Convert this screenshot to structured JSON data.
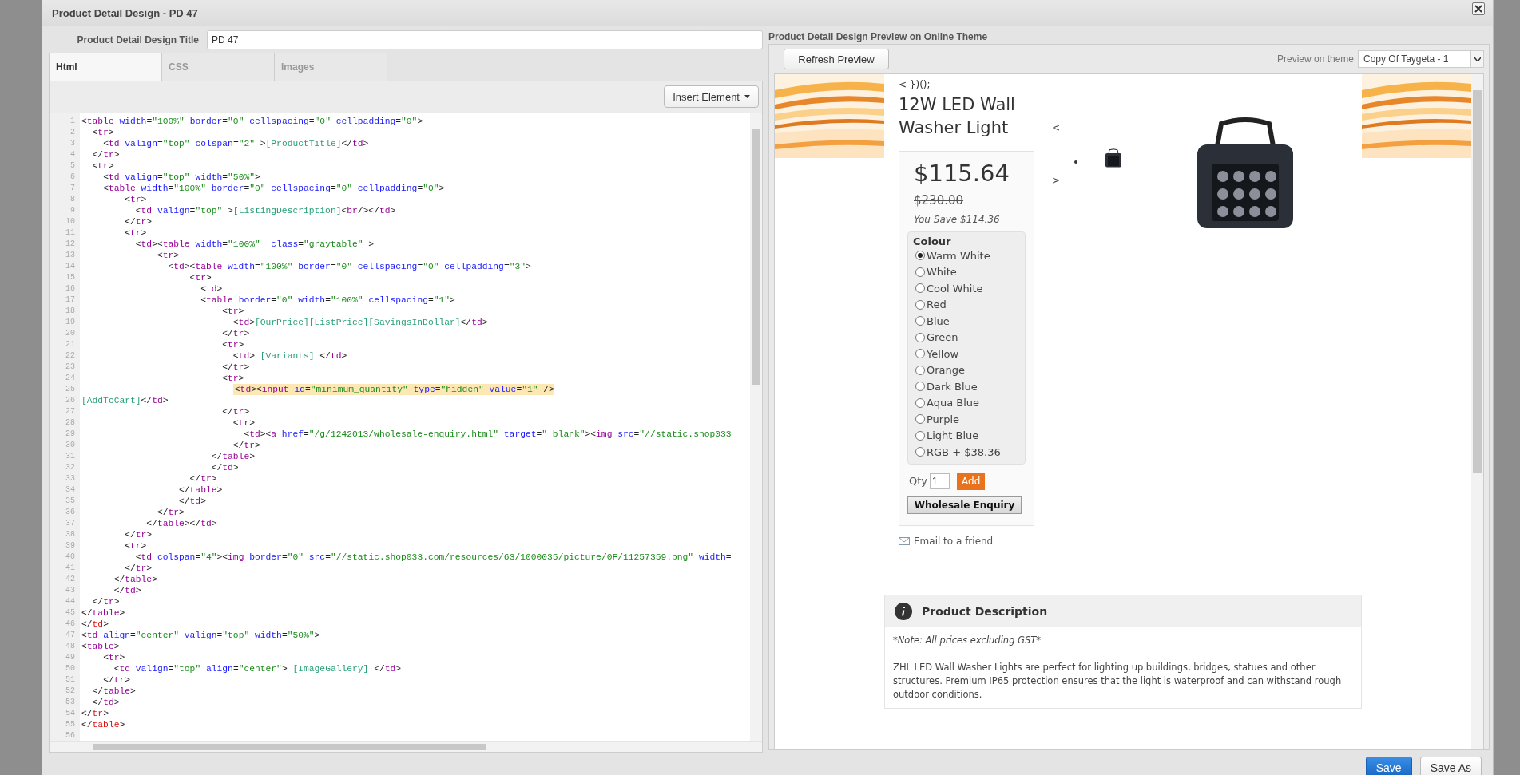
{
  "dialog": {
    "title": "Product Detail Design - PD 47"
  },
  "design_title": {
    "label": "Product Detail Design Title",
    "value": "PD 47"
  },
  "tabs": [
    {
      "label": "Html",
      "selected": true
    },
    {
      "label": "CSS",
      "selected": false
    },
    {
      "label": "Images",
      "selected": false
    }
  ],
  "insert_button": "Insert Element",
  "code_lines": [
    {
      "number": "1",
      "text": "<table width=\"100%\" border=\"0\" cellspacing=\"0\" cellpadding=\"0\">",
      "kind": "plain"
    },
    {
      "number": "2",
      "text": "  <tr>",
      "kind": "plain"
    },
    {
      "number": "3",
      "text": "    <td valign=\"top\" colspan=\"2\" >[ProductTitle]</td>",
      "kind": "plain"
    },
    {
      "number": "4",
      "text": "  </tr>",
      "kind": "plain"
    },
    {
      "number": "5",
      "text": "  <tr>",
      "kind": "plain"
    },
    {
      "number": "6",
      "text": "    <td valign=\"top\" width=\"50%\">",
      "kind": "plain"
    },
    {
      "number": "7",
      "text": "    <table width=\"100%\" border=\"0\" cellspacing=\"0\" cellpadding=\"0\">",
      "kind": "plain"
    },
    {
      "number": "8",
      "text": "        <tr>",
      "kind": "plain"
    },
    {
      "number": "9",
      "text": "          <td valign=\"top\" >[ListingDescription]<br/></td>",
      "kind": "plain"
    },
    {
      "number": "10",
      "text": "        </tr>",
      "kind": "plain"
    },
    {
      "number": "11",
      "text": "        <tr>",
      "kind": "plain"
    },
    {
      "number": "12",
      "text": "          <td><table width=\"100%\"  class=\"graytable\" >",
      "kind": "plain"
    },
    {
      "number": "13",
      "text": "              <tr>",
      "kind": "plain"
    },
    {
      "number": "14",
      "text": "                <td><table width=\"100%\" border=\"0\" cellspacing=\"0\" cellpadding=\"3\">",
      "kind": "plain"
    },
    {
      "number": "15",
      "text": "                    <tr>",
      "kind": "plain"
    },
    {
      "number": "16",
      "text": "                      <td>",
      "kind": "plain"
    },
    {
      "number": "17",
      "text": "                      <table border=\"0\" width=\"100%\" cellspacing=\"1\">",
      "kind": "plain"
    },
    {
      "number": "18",
      "text": "                          <tr>",
      "kind": "plain"
    },
    {
      "number": "19",
      "text": "                            <td>[OurPrice][ListPrice][SavingsInDollar]</td>",
      "kind": "plain"
    },
    {
      "number": "20",
      "text": "                          </tr>",
      "kind": "plain"
    },
    {
      "number": "21",
      "text": "                          <tr>",
      "kind": "plain"
    },
    {
      "number": "22",
      "text": "                            <td> [Variants] </td>",
      "kind": "plain"
    },
    {
      "number": "23",
      "text": "                          </tr>",
      "kind": "plain"
    },
    {
      "number": "24",
      "text": "                          <tr>",
      "kind": "plain"
    },
    {
      "number": "25",
      "text": "                            <td><input id=\"minimum_quantity\" type=\"hidden\" value=\"1\" />",
      "kind": "highlight"
    },
    {
      "number": "26",
      "text": "[AddToCart]</td>",
      "kind": "plain"
    },
    {
      "number": "27",
      "text": "                          </tr>",
      "kind": "plain"
    },
    {
      "number": "28",
      "text": "                            <tr>",
      "kind": "plain"
    },
    {
      "number": "29",
      "text": "                              <td><a href=\"/g/1242013/wholesale-enquiry.html\" target=\"_blank\"><img src=\"//static.shop033",
      "kind": "plain"
    },
    {
      "number": "30",
      "text": "                            </tr>",
      "kind": "plain"
    },
    {
      "number": "31",
      "text": "                        </table>",
      "kind": "plain"
    },
    {
      "number": "32",
      "text": "                        </td>",
      "kind": "plain"
    },
    {
      "number": "33",
      "text": "                    </tr>",
      "kind": "plain"
    },
    {
      "number": "34",
      "text": "                  </table>",
      "kind": "plain"
    },
    {
      "number": "35",
      "text": "                  </td>",
      "kind": "plain"
    },
    {
      "number": "36",
      "text": "              </tr>",
      "kind": "plain"
    },
    {
      "number": "37",
      "text": "            </table></td>",
      "kind": "plain"
    },
    {
      "number": "38",
      "text": "        </tr>",
      "kind": "plain"
    },
    {
      "number": "39",
      "text": "        <tr>",
      "kind": "plain"
    },
    {
      "number": "40",
      "text": "          <td colspan=\"4\"><img border=\"0\" src=\"//static.shop033.com/resources/63/1000035/picture/0F/11257359.png\" width=",
      "kind": "plain"
    },
    {
      "number": "41",
      "text": "        </tr>",
      "kind": "plain"
    },
    {
      "number": "42",
      "text": "      </table>",
      "kind": "plain"
    },
    {
      "number": "43",
      "text": "      </td>",
      "kind": "plain"
    },
    {
      "number": "44",
      "text": "  </tr>",
      "kind": "plain"
    },
    {
      "number": "45",
      "text": "</table>",
      "kind": "plain"
    },
    {
      "number": "46",
      "text": "</td>",
      "kind": "unmatched"
    },
    {
      "number": "47",
      "text": "<td align=\"center\" valign=\"top\" width=\"50%\">",
      "kind": "plain"
    },
    {
      "number": "48",
      "text": "<table>",
      "kind": "plain"
    },
    {
      "number": "49",
      "text": "    <tr>",
      "kind": "plain"
    },
    {
      "number": "50",
      "text": "      <td valign=\"top\" align=\"center\"> [ImageGallery] </td>",
      "kind": "plain"
    },
    {
      "number": "51",
      "text": "    </tr>",
      "kind": "plain"
    },
    {
      "number": "52",
      "text": "  </table>",
      "kind": "plain"
    },
    {
      "number": "53",
      "text": "  </td>",
      "kind": "plain"
    },
    {
      "number": "54",
      "text": "</tr>",
      "kind": "unmatched"
    },
    {
      "number": "55",
      "text": "</table>",
      "kind": "unmatched"
    },
    {
      "number": "56",
      "kind": "plain"
    }
  ],
  "preview": {
    "heading": "Product Detail Design Preview on Online Theme",
    "refresh_button": "Refresh Preview",
    "theme_label": "Preview on theme",
    "theme_value": "Copy Of Taygeta - 1",
    "script_residue": "< })();",
    "product_title": "12W LED Wall Washer Light",
    "price": "$115.64",
    "list_price": "$230.00",
    "savings": "You Save $114.36",
    "variant_label": "Colour",
    "variants": [
      {
        "label": "Warm White",
        "selected": true
      },
      {
        "label": "White",
        "selected": false
      },
      {
        "label": "Cool White",
        "selected": false
      },
      {
        "label": "Red",
        "selected": false
      },
      {
        "label": "Blue",
        "selected": false
      },
      {
        "label": "Green",
        "selected": false
      },
      {
        "label": "Yellow",
        "selected": false
      },
      {
        "label": "Orange",
        "selected": false
      },
      {
        "label": "Dark Blue",
        "selected": false
      },
      {
        "label": "Aqua Blue",
        "selected": false
      },
      {
        "label": "Purple",
        "selected": false
      },
      {
        "label": "Light Blue",
        "selected": false
      },
      {
        "label": "RGB + $38.36",
        "selected": false
      }
    ],
    "qty_label": "Qty",
    "qty_value": "1",
    "add_button": "Add",
    "wholesale_button": "Wholesale Enquiry",
    "gallery_prev": "<",
    "gallery_next": ">",
    "email_link": "Email to a friend",
    "description": {
      "title": "Product Description",
      "note": "*Note: All prices excluding GST*",
      "body": "ZHL LED Wall Washer Lights are perfect for lighting up buildings, bridges, statues and other structures. Premium IP65 protection ensures that the light is waterproof and can withstand rough outdoor conditions."
    }
  },
  "footer_buttons": [
    {
      "label": "Save",
      "kind": "primary"
    },
    {
      "label": "Save As",
      "kind": "default"
    }
  ]
}
